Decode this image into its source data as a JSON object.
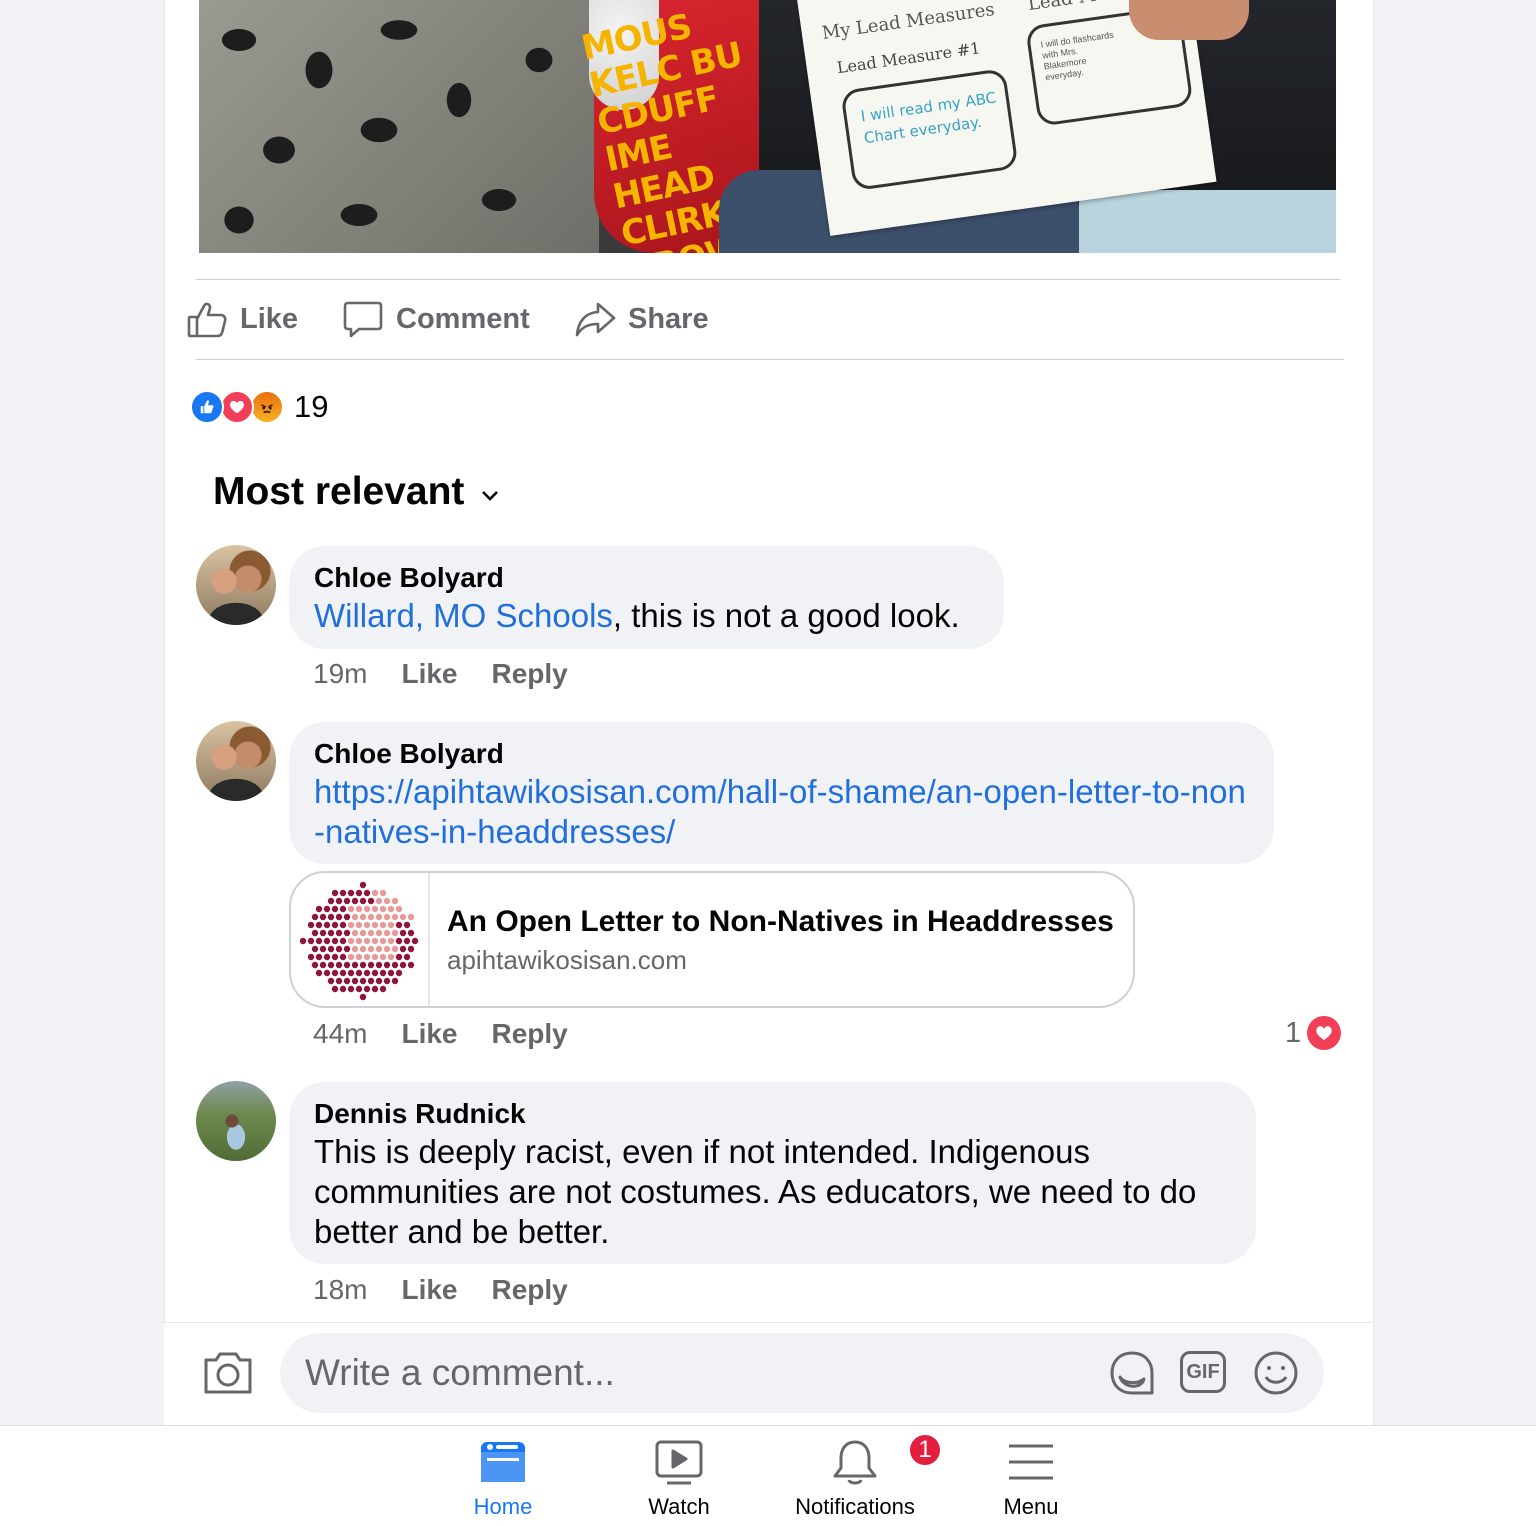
{
  "post": {
    "photo": {
      "shirt_text": "MOUS KELC BU CDUFF IME HEAD CLIRK A BROWN",
      "paper_title_1": "My Lead Measures",
      "paper_title_2": "Lead Measu",
      "paper_label": "Lead Measure #1",
      "paper_box1": "I will read my ABC Chart everyday.",
      "paper_box2": "I will do flashcards with Mrs. Blakemore everyday."
    },
    "actions": {
      "like_label": "Like",
      "comment_label": "Comment",
      "share_label": "Share"
    },
    "reactions": {
      "types": [
        "like",
        "love",
        "angry"
      ],
      "count": "19"
    }
  },
  "comments_sort": {
    "label": "Most relevant"
  },
  "comments": [
    {
      "author": "Chloe Bolyard",
      "mention": "Willard, MO Schools",
      "text": ", this is not a good look.",
      "time": "19m",
      "like_label": "Like",
      "reply_label": "Reply"
    },
    {
      "author": "Chloe Bolyard",
      "link": "https://apihtawikosisan.com/hall-of-shame/an-open-letter-to-non-natives-in-headdresses/",
      "preview": {
        "title": "An Open Letter to Non-Natives in Headdresses",
        "domain": "apihtawikosisan.com"
      },
      "time": "44m",
      "like_label": "Like",
      "reply_label": "Reply",
      "reaction_count": "1"
    },
    {
      "author": "Dennis Rudnick",
      "text": "This is deeply racist, even if not intended. Indigenous communities are not costumes. As educators, we need to do better and be better.",
      "time": "18m",
      "like_label": "Like",
      "reply_label": "Reply"
    }
  ],
  "composer": {
    "placeholder": "Write a comment...",
    "gif_label": "GIF",
    "icons": [
      "camera-icon",
      "sticker-icon",
      "gif-icon",
      "emoji-icon"
    ]
  },
  "bottom_nav": {
    "tabs": [
      {
        "label": "Home",
        "icon": "home-icon",
        "active": true
      },
      {
        "label": "Watch",
        "icon": "watch-icon",
        "active": false
      },
      {
        "label": "Notifications",
        "icon": "bell-icon",
        "active": false,
        "badge": "1"
      },
      {
        "label": "Menu",
        "icon": "menu-icon",
        "active": false
      }
    ]
  },
  "colors": {
    "accent": "#1877f2",
    "link": "#216fdb",
    "secondary_text": "#65676b",
    "bubble": "#f0f2f5",
    "badge": "#e41e3f"
  }
}
